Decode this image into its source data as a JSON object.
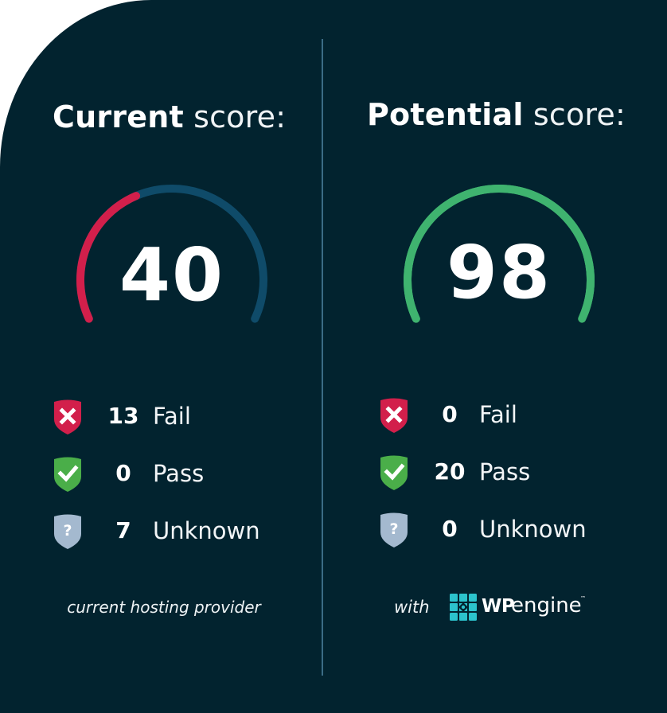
{
  "colors": {
    "background": "#02232f",
    "divider": "#3c6c86",
    "fail": "#d21f4b",
    "pass": "#4aae49",
    "unknown": "#a4b9cf",
    "gauge_track": "#0f4b69",
    "gauge_potential": "#3fb36f",
    "logo_teal": "#2cc3cc"
  },
  "current": {
    "title_bold": "Current",
    "title_light": " score:",
    "score": "40",
    "score_fraction": 0.4,
    "gauge_fill_color": "#d21f4b",
    "stats": [
      {
        "icon": "shield-x-icon",
        "value": "13",
        "label": "Fail"
      },
      {
        "icon": "shield-check-icon",
        "value": "0",
        "label": "Pass"
      },
      {
        "icon": "shield-question-icon",
        "value": "7",
        "label": "Unknown"
      }
    ],
    "footer": "current hosting provider"
  },
  "potential": {
    "title_bold": "Potential",
    "title_light": " score:",
    "score": "98",
    "score_fraction": 0.98,
    "gauge_fill_color": "#3fb36f",
    "stats": [
      {
        "icon": "shield-x-icon",
        "value": "0",
        "label": "Fail"
      },
      {
        "icon": "shield-check-icon",
        "value": "20",
        "label": "Pass"
      },
      {
        "icon": "shield-question-icon",
        "value": "0",
        "label": "Unknown"
      }
    ],
    "footer_prefix": "with",
    "brand": {
      "wp": "WP",
      "engine": "engine",
      "tm": "™"
    }
  }
}
